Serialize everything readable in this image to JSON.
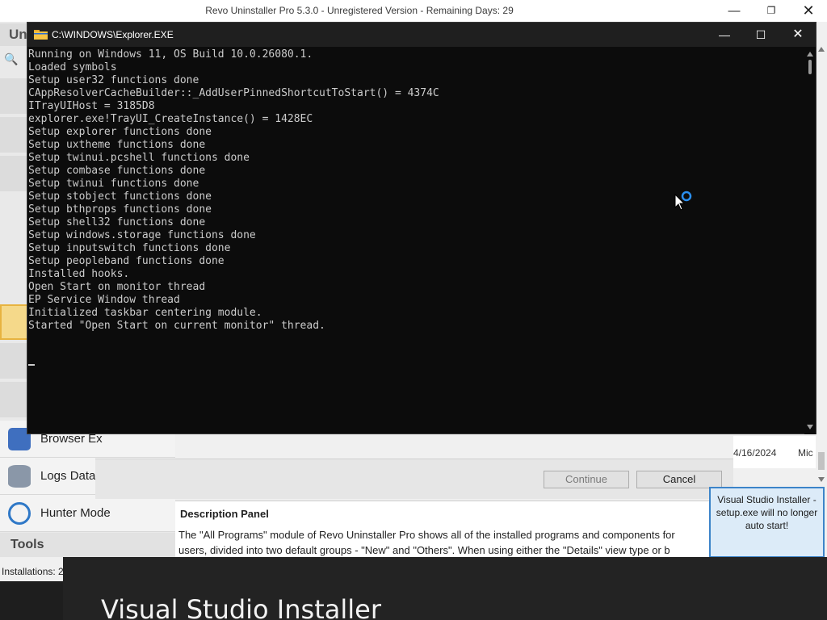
{
  "revo": {
    "title": "Revo Uninstaller Pro 5.3.0 - Unregistered Version - Remaining Days: 29",
    "tab_stub": "Un",
    "sidebar": [
      {
        "label": "Browser Ex",
        "icon": "browser-extension-icon",
        "color": "#3f6fbf"
      },
      {
        "label": "Logs Data",
        "icon": "logs-database-icon",
        "color": "#6e7f94"
      },
      {
        "label": "Hunter Mode",
        "icon": "crosshair-icon",
        "color": "#2f78c7"
      }
    ],
    "tools_header": "Tools",
    "status": "Installations: 2",
    "dialog": {
      "continue_label": "Continue",
      "cancel_label": "Cancel"
    },
    "list_row": {
      "date": "4/16/2024",
      "publisher": "Mic"
    },
    "description": {
      "title": "Description Panel",
      "line1": "The \"All Programs\" module of Revo Uninstaller Pro shows all of the installed programs and components for",
      "line2": "users, divided into two default groups - \"New\" and \"Others\". When using either the \"Details\" view type or b"
    },
    "notification": "Visual Studio Installer - setup.exe will no longer auto start!"
  },
  "console": {
    "title": "C:\\WINDOWS\\Explorer.EXE",
    "lines": [
      "Running on Windows 11, OS Build 10.0.26080.1.",
      "Loaded symbols",
      "Setup user32 functions done",
      "CAppResolverCacheBuilder::_AddUserPinnedShortcutToStart() = 4374C",
      "ITrayUIHost = 3185D8",
      "explorer.exe!TrayUI_CreateInstance() = 1428EC",
      "Setup explorer functions done",
      "Setup uxtheme functions done",
      "Setup twinui.pcshell functions done",
      "Setup combase functions done",
      "Setup twinui functions done",
      "Setup stobject functions done",
      "Setup bthprops functions done",
      "Setup shell32 functions done",
      "Setup windows.storage functions done",
      "Setup inputswitch functions done",
      "Setup peopleband functions done",
      "Installed hooks.",
      "Open Start on monitor thread",
      "EP Service Window thread",
      "Initialized taskbar centering module.",
      "Started \"Open Start on current monitor\" thread."
    ]
  },
  "vs_installer": {
    "title": "Visual Studio Installer"
  },
  "colors": {
    "console_bg": "#0c0c0c",
    "console_text": "#cccccc",
    "accent": "#3c84c9"
  }
}
